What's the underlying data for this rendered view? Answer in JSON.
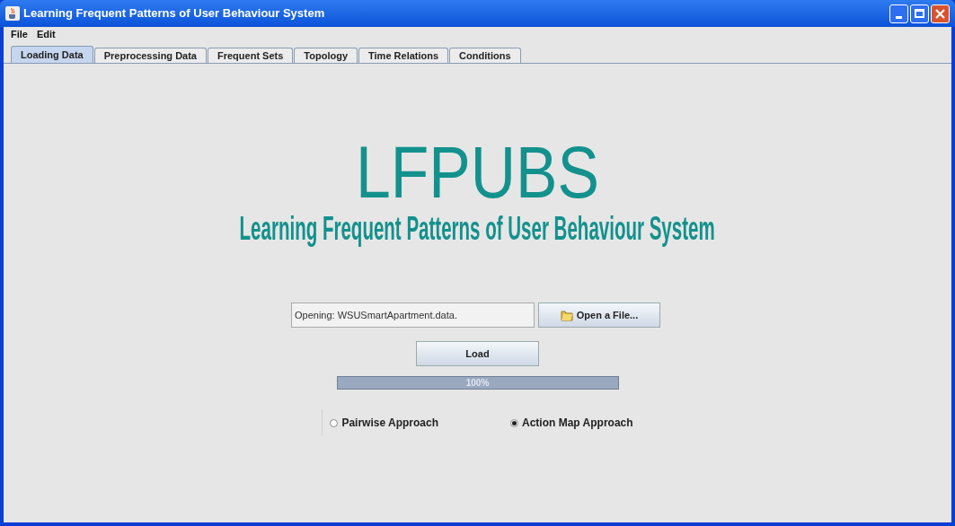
{
  "window": {
    "title": "Learning Frequent Patterns of User Behaviour System"
  },
  "menu": [
    "File",
    "Edit"
  ],
  "tabs": [
    {
      "label": "Loading Data",
      "selected": true
    },
    {
      "label": "Preprocessing Data",
      "selected": false
    },
    {
      "label": "Frequent Sets",
      "selected": false
    },
    {
      "label": "Topology",
      "selected": false
    },
    {
      "label": "Time Relations",
      "selected": false
    },
    {
      "label": "Conditions",
      "selected": false
    }
  ],
  "logo": {
    "title": "LFPUBS",
    "subtitle": "Learning Frequent Patterns of User Behaviour System"
  },
  "file_field": {
    "value": "Opening: WSUSmartApartment.data."
  },
  "open_button": "Open a File...",
  "load_button": "Load",
  "progress": {
    "level": 1,
    "reading": "100%"
  },
  "approaches": [
    {
      "label": "Pairwise Approach",
      "selected": false
    },
    {
      "label": "Action Map Approach",
      "selected": true
    }
  ]
}
